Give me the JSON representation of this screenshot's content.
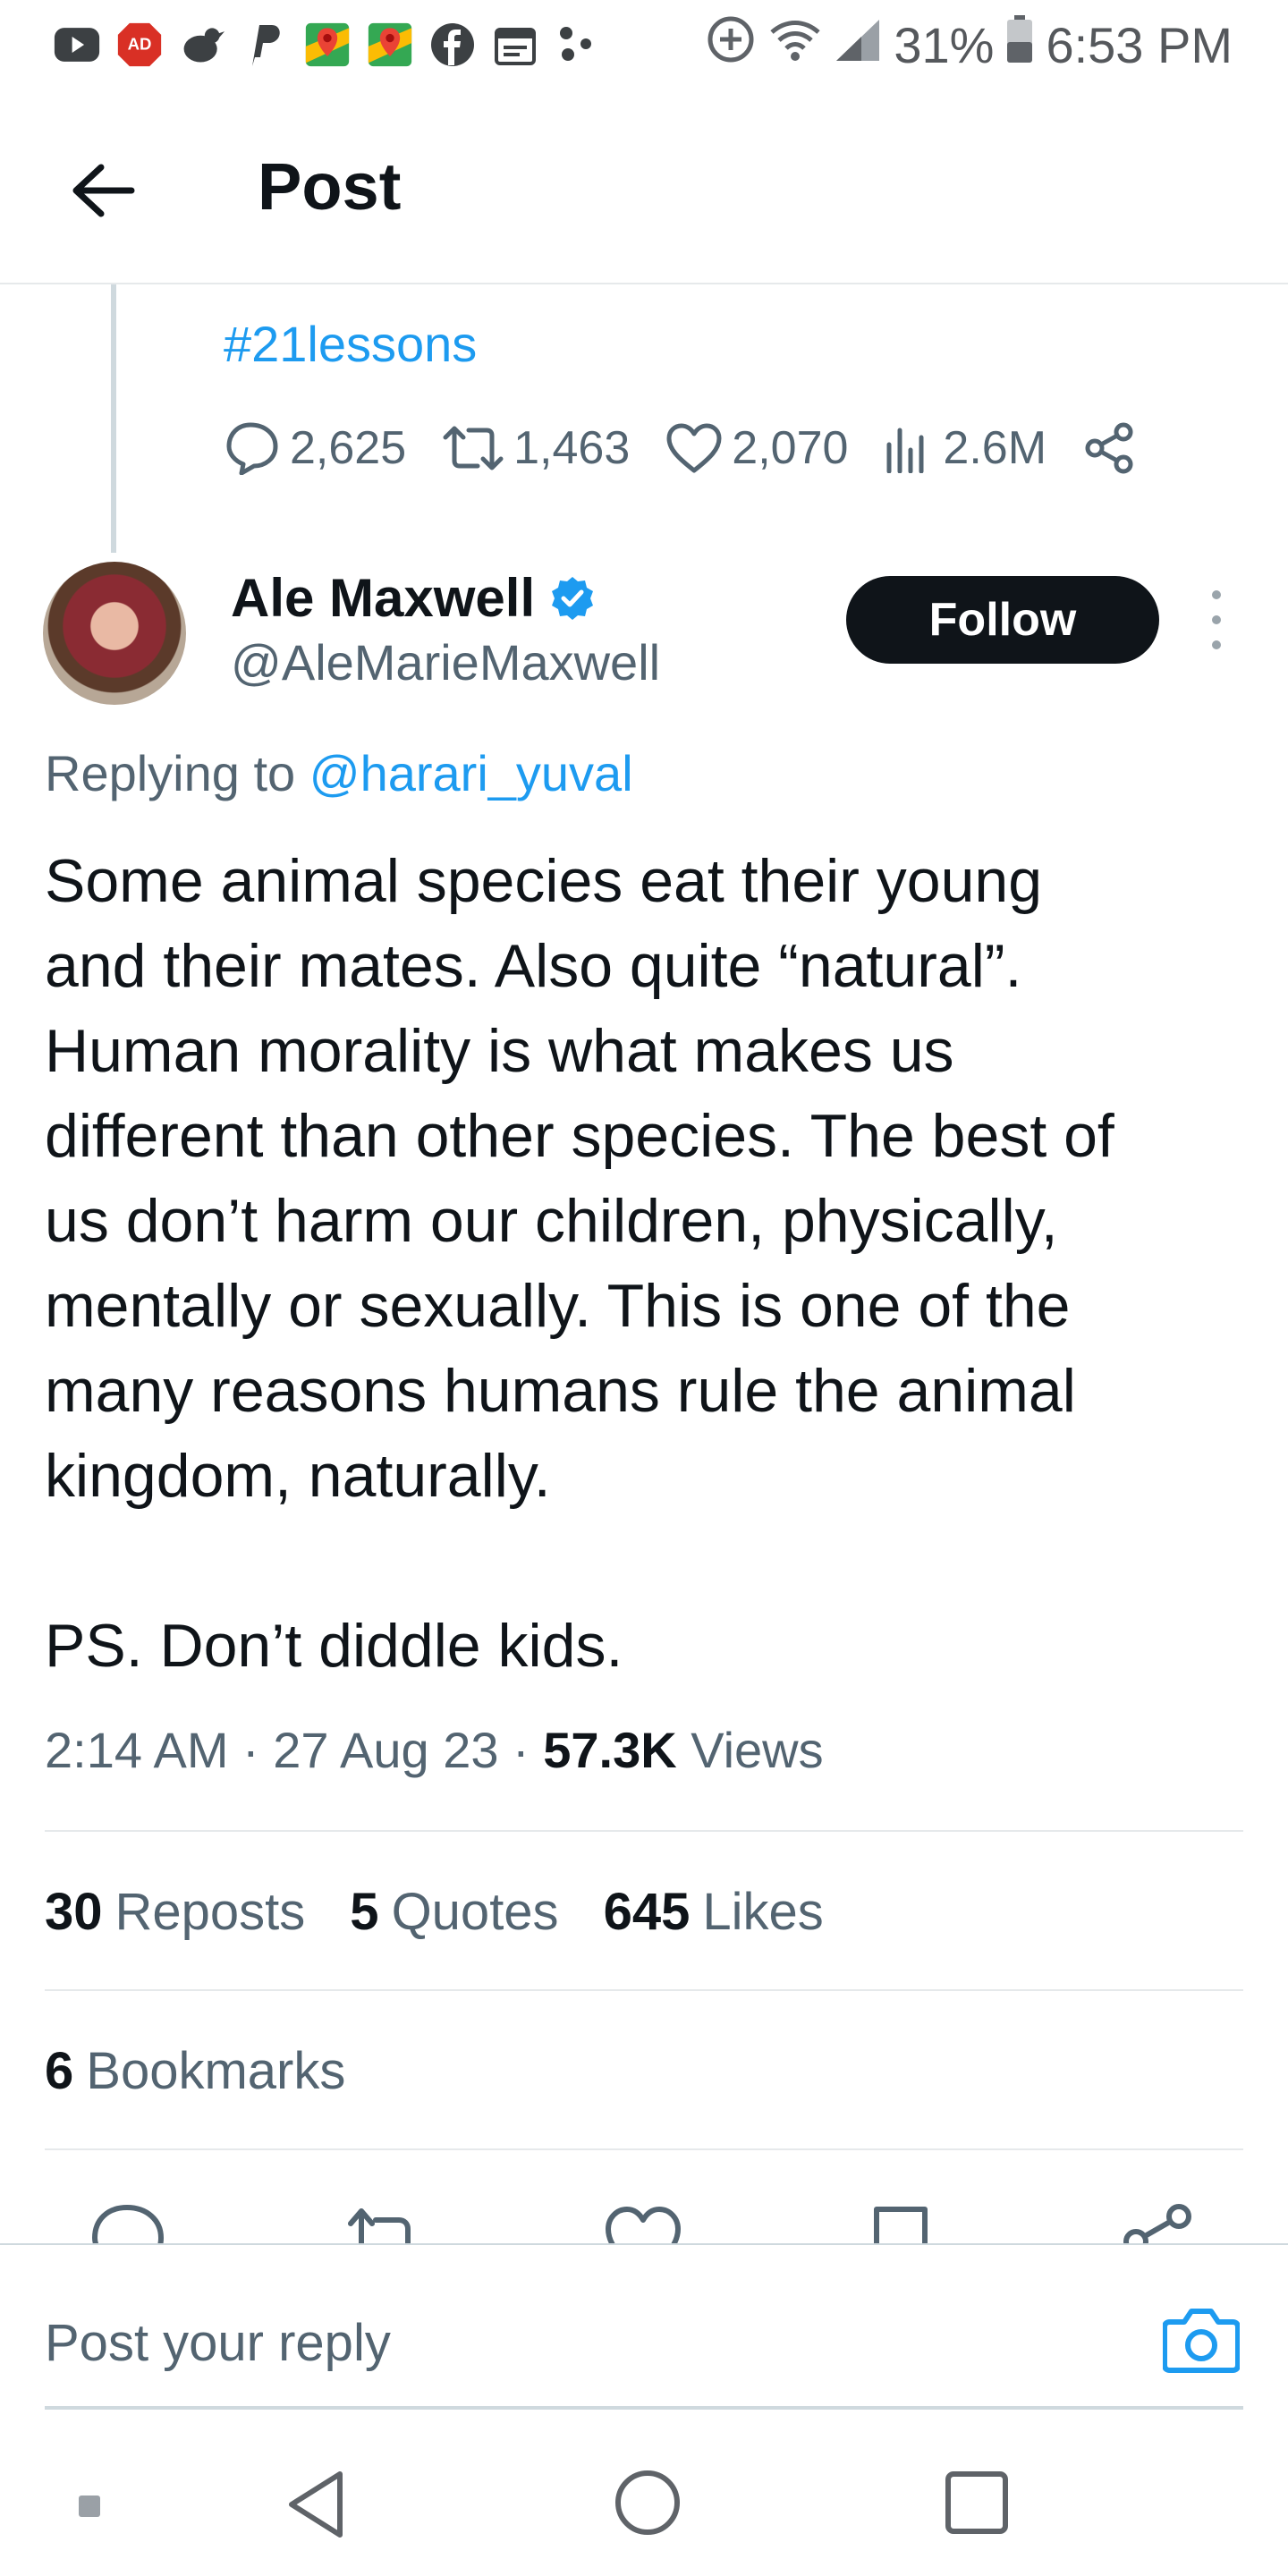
{
  "status_bar": {
    "left_icons": [
      "youtube-icon",
      "ad-blocker-icon",
      "bird-icon",
      "paypal-icon",
      "maps-icon",
      "maps-icon",
      "facebook-icon",
      "calendar-icon",
      "dots-icon"
    ],
    "ad_blocker_label": "AD",
    "battery": "31%",
    "time": "6:53 PM"
  },
  "header": {
    "title": "Post"
  },
  "previous_tweet": {
    "hashtag": "#21lessons",
    "replies": "2,625",
    "reposts": "1,463",
    "likes": "2,070",
    "views": "2.6M"
  },
  "author": {
    "name": "Ale Maxwell",
    "handle": "@AleMarieMaxwell",
    "follow_label": "Follow"
  },
  "replying": {
    "prefix": "Replying to ",
    "mention": "@harari_yuval"
  },
  "tweet": {
    "text": "Some animal species eat their young\nand their mates. Also quite “natural”.\nHuman morality is what makes us\ndifferent than other species. The best of\nus don’t harm our children, physically,\nmentally or sexually. This is one of the\nmany reasons humans rule the animal\nkingdom, naturally.\n\nPS. Don’t diddle kids.",
    "time": "2:14 AM",
    "date": "27 Aug 23",
    "views_count": "57.3K",
    "views_label": "Views"
  },
  "counts": {
    "reposts_num": "30",
    "reposts_label": "Reposts",
    "quotes_num": "5",
    "quotes_label": "Quotes",
    "likes_num": "645",
    "likes_label": "Likes",
    "bookmarks_num": "6",
    "bookmarks_label": "Bookmarks"
  },
  "reply_bar": {
    "placeholder": "Post your reply"
  },
  "colors": {
    "accent": "#1d9bf0",
    "text": "#0f1419",
    "muted": "#536471",
    "border": "#e6e9eb"
  }
}
